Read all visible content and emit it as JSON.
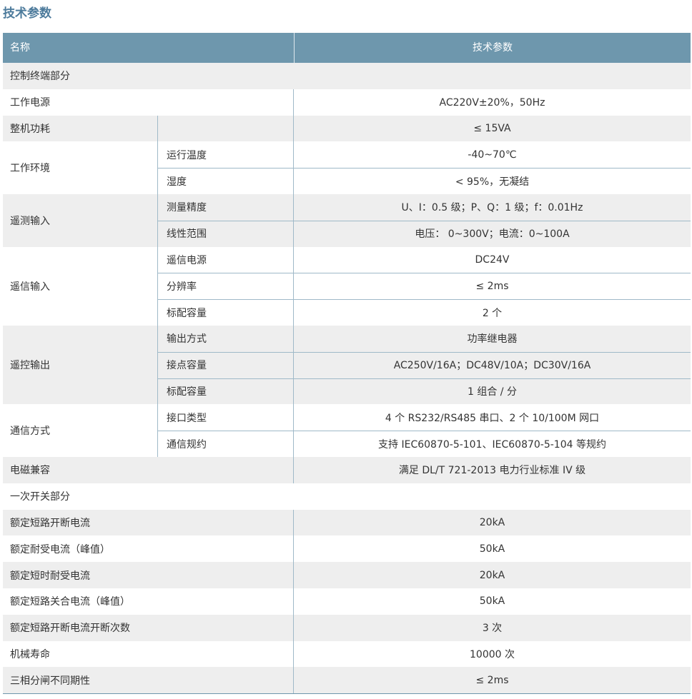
{
  "title": "技术参数",
  "header": {
    "name": "名称",
    "value": "技术参数"
  },
  "sections": [
    {
      "name": "控制终端部分",
      "subs": [
        {
          "label": "",
          "value": ""
        }
      ]
    },
    {
      "name": "工作电源",
      "subs": [
        {
          "label": "",
          "value": "AC220V±20%，50Hz"
        }
      ]
    },
    {
      "name": "整机功耗",
      "subs": [
        {
          "label": "",
          "value": "≤ 15VA"
        }
      ]
    },
    {
      "name": "工作环境",
      "subs": [
        {
          "label": "运行温度",
          "value": "-40~70℃"
        },
        {
          "label": "湿度",
          "value": "< 95%，无凝结"
        }
      ]
    },
    {
      "name": "遥测输入",
      "subs": [
        {
          "label": "测量精度",
          "value": "U、I：0.5 级；P、Q：1 级；f：0.01Hz"
        },
        {
          "label": "线性范围",
          "value": "电压： 0~300V；电流：0~100A"
        }
      ]
    },
    {
      "name": "遥信输入",
      "subs": [
        {
          "label": "遥信电源",
          "value": "DC24V"
        },
        {
          "label": "分辨率",
          "value": "≤ 2ms"
        },
        {
          "label": "标配容量",
          "value": "2 个"
        }
      ]
    },
    {
      "name": "遥控输出",
      "subs": [
        {
          "label": "输出方式",
          "value": "功率继电器"
        },
        {
          "label": "接点容量",
          "value": "AC250V/16A；DC48V/10A；DC30V/16A"
        },
        {
          "label": "标配容量",
          "value": "1 组合 / 分"
        }
      ]
    },
    {
      "name": "通信方式",
      "subs": [
        {
          "label": "接口类型",
          "value": "4 个 RS232/RS485 串口、2 个 10/100M 网口"
        },
        {
          "label": "通信规约",
          "value": "支持 IEC60870-5-101、IEC60870-5-104 等规约"
        }
      ]
    },
    {
      "name": "电磁兼容",
      "subs": [
        {
          "label": "",
          "value": "满足 DL/T 721-2013 电力行业标准 IV 级"
        }
      ]
    },
    {
      "name": "一次开关部分",
      "subs": [
        {
          "label": "",
          "value": ""
        }
      ]
    },
    {
      "name": "额定短路开断电流",
      "subs": [
        {
          "label": "",
          "value": "20kA"
        }
      ]
    },
    {
      "name": "额定耐受电流（峰值）",
      "subs": [
        {
          "label": "",
          "value": "50kA"
        }
      ]
    },
    {
      "name": "额定短时耐受电流",
      "subs": [
        {
          "label": "",
          "value": "20kA"
        }
      ]
    },
    {
      "name": "额定短路关合电流（峰值）",
      "subs": [
        {
          "label": "",
          "value": "50kA"
        }
      ]
    },
    {
      "name": "额定短路开断电流开断次数",
      "subs": [
        {
          "label": "",
          "value": "3 次"
        }
      ]
    },
    {
      "name": "机械寿命",
      "subs": [
        {
          "label": "",
          "value": "10000 次"
        }
      ]
    },
    {
      "name": "三相分闸不同期性",
      "subs": [
        {
          "label": "",
          "value": "≤ 2ms"
        }
      ]
    }
  ]
}
